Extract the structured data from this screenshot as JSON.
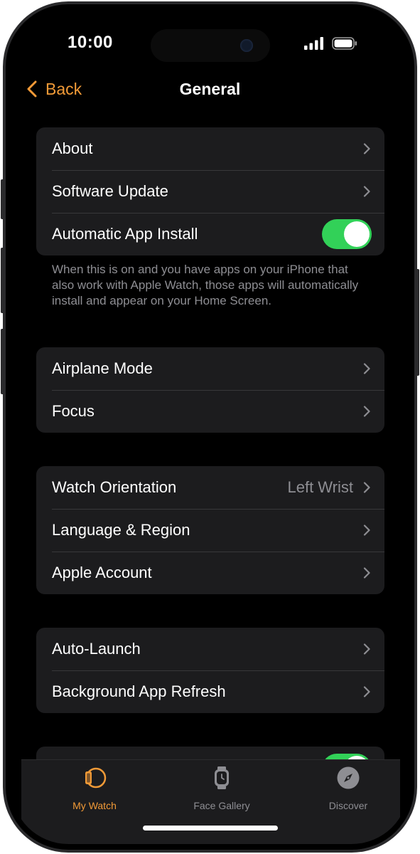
{
  "status_bar": {
    "time": "10:00"
  },
  "nav": {
    "back_label": "Back",
    "title": "General"
  },
  "groups": [
    {
      "rows": [
        {
          "label": "About"
        },
        {
          "label": "Software Update"
        },
        {
          "label": "Automatic App Install",
          "toggle": true
        }
      ],
      "footnote": "When this is on and you have apps on your iPhone that also work with Apple Watch, those apps will automatically install and appear on your Home Screen."
    },
    {
      "rows": [
        {
          "label": "Airplane Mode"
        },
        {
          "label": "Focus"
        }
      ]
    },
    {
      "rows": [
        {
          "label": "Watch Orientation",
          "value": "Left Wrist"
        },
        {
          "label": "Language & Region"
        },
        {
          "label": "Apple Account"
        }
      ]
    },
    {
      "rows": [
        {
          "label": "Auto-Launch"
        },
        {
          "label": "Background App Refresh"
        }
      ]
    }
  ],
  "tab_bar": {
    "tabs": [
      {
        "label": "My Watch",
        "icon": "watch-icon",
        "active": true
      },
      {
        "label": "Face Gallery",
        "icon": "watch-face-icon",
        "active": false
      },
      {
        "label": "Discover",
        "icon": "compass-icon",
        "active": false
      }
    ]
  },
  "colors": {
    "accent": "#f19a37",
    "toggle_on": "#32d158",
    "background": "#000000",
    "cell": "#1c1c1e",
    "secondary_text": "#8e8e93"
  }
}
